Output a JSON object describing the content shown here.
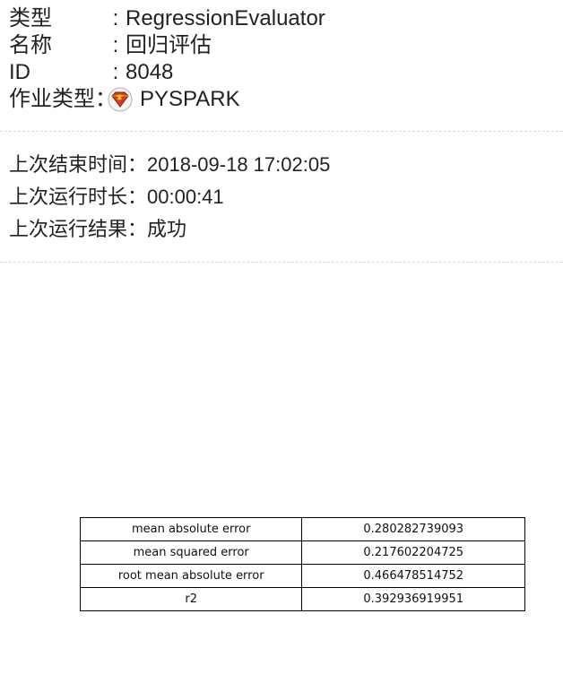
{
  "info": {
    "type_label": "类型",
    "type_value": "RegressionEvaluator",
    "name_label": "名称",
    "name_value": "回归评估",
    "id_label": "ID",
    "id_value": "8048",
    "job_type_label": "作业类型",
    "job_type_value": "PYSPARK",
    "job_type_icon": "pyspark-logo-icon",
    "colon": "：",
    "colon_narrow": ":"
  },
  "run": {
    "last_end_time_label": "上次结束时间：",
    "last_end_time_value": "2018-09-18 17:02:05",
    "last_duration_label": "上次运行时长：",
    "last_duration_value": "00:00:41",
    "last_result_label": "上次运行结果：",
    "last_result_value": "成功"
  },
  "metrics": {
    "rows": [
      {
        "name": "mean absolute error",
        "value": "0.280282739093"
      },
      {
        "name": "mean squared error",
        "value": "0.217602204725"
      },
      {
        "name": "root mean absolute error",
        "value": "0.466478514752"
      },
      {
        "name": "r2",
        "value": "0.392936919951"
      }
    ]
  }
}
